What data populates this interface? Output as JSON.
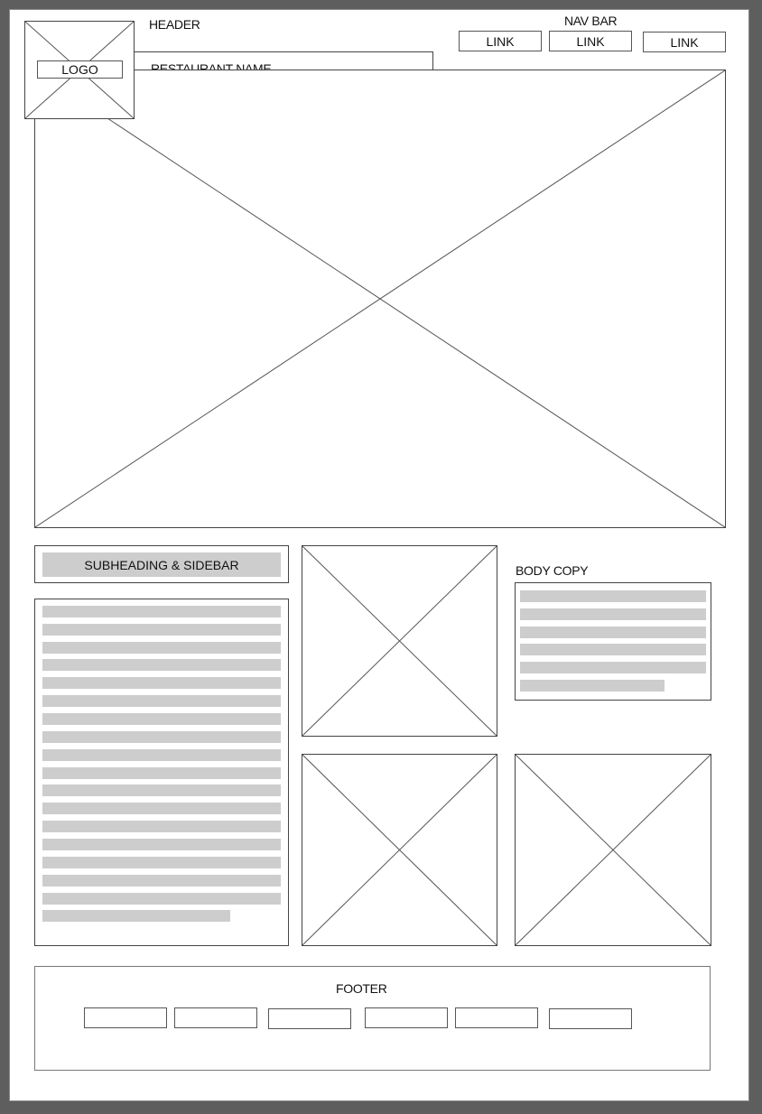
{
  "header": {
    "label": "HEADER",
    "logo_label": "LOGO",
    "restaurant_name": "RESTAURANT NAME"
  },
  "nav": {
    "label": "NAV BAR",
    "links": [
      "LINK",
      "LINK",
      "LINK"
    ]
  },
  "sidebar": {
    "subheading": "SUBHEADING & SIDEBAR"
  },
  "body_copy": {
    "label": "BODY COPY"
  },
  "footer": {
    "label": "FOOTER"
  },
  "colors": {
    "background": "#5e5e5e",
    "page": "#ffffff",
    "text_placeholder": "#cdcdcd",
    "outline": "#444444"
  }
}
